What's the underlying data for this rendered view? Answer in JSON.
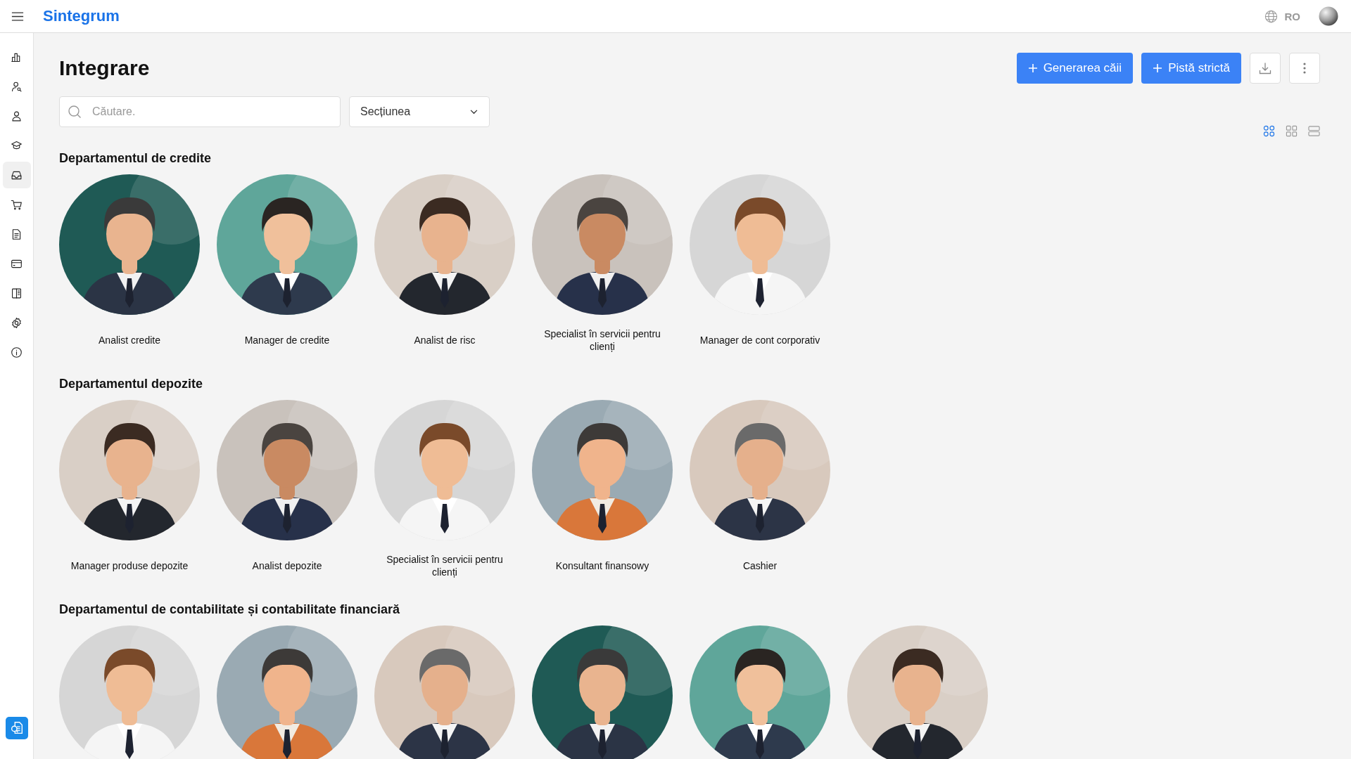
{
  "header": {
    "brand": "Sintegrum",
    "language": "RO"
  },
  "sidebar": {
    "items": [
      {
        "selected": false
      },
      {
        "selected": false
      },
      {
        "selected": false
      },
      {
        "selected": false
      },
      {
        "selected": true
      },
      {
        "selected": false
      },
      {
        "selected": false
      },
      {
        "selected": false
      },
      {
        "selected": false
      },
      {
        "selected": false
      },
      {
        "selected": false
      }
    ]
  },
  "page": {
    "title": "Integrare",
    "actions": [
      "Generarea căii",
      "Pistă strictă"
    ],
    "search": {
      "placeholder": "Căutare."
    },
    "section_select": {
      "value": "Secțiunea"
    },
    "view_modes": [
      {
        "selected": true
      },
      {
        "selected": false
      },
      {
        "selected": false
      }
    ]
  },
  "sections": [
    {
      "title": "Departamentul de credite",
      "members": [
        {
          "kind": "picture",
          "label": "Analist credite"
        },
        {
          "kind": "picture",
          "label": "Manager de credite"
        },
        {
          "kind": "picture",
          "label": "Analist de risc"
        },
        {
          "kind": "picture",
          "label": "Specialist în servicii pentru clienți"
        },
        {
          "kind": "picture",
          "label": "Manager de cont corporativ"
        }
      ]
    },
    {
      "title": "Departamentul depozite",
      "members": [
        {
          "kind": "picture",
          "label": "Manager produse depozite"
        },
        {
          "kind": "picture",
          "label": "Analist depozite"
        },
        {
          "kind": "picture",
          "label": "Specialist în servicii pentru clienți"
        },
        {
          "kind": "picture",
          "label": "Konsultant finansowy"
        },
        {
          "kind": "picture",
          "label": "Cashier"
        }
      ]
    },
    {
      "title": "Departamentul de contabilitate și contabilitate financiară"
    }
  ]
}
